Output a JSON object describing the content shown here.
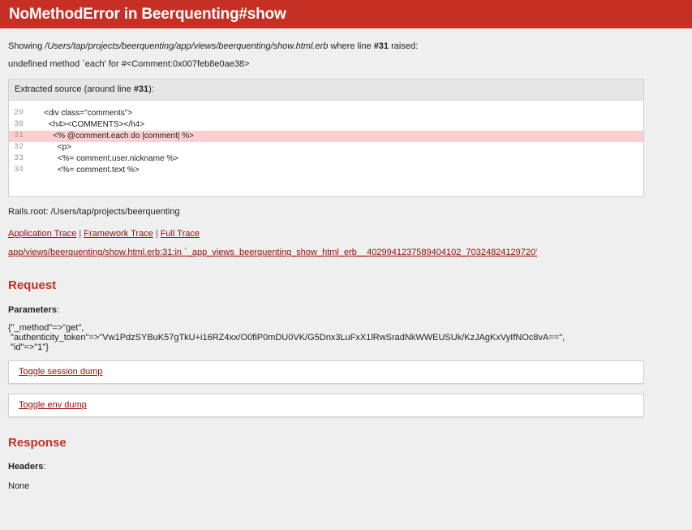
{
  "header": {
    "title": "NoMethodError in Beerquenting#show"
  },
  "showing": {
    "prefix": "Showing ",
    "path": "/Users/tap/projects/beerquenting/app/views/beerquenting/show.html.erb",
    "middle": " where line ",
    "line": "#31",
    "suffix": " raised:"
  },
  "error_message": "undefined method `each' for #<Comment:0x007feb8e0ae38>",
  "source": {
    "head_prefix": "Extracted source (around line ",
    "head_line": "#31",
    "head_suffix": "):",
    "lines": [
      {
        "num": "29",
        "code": "    <div class=\"comments\">"
      },
      {
        "num": "30",
        "code": "      <h4><COMMENTS></h4>"
      },
      {
        "num": "31",
        "code": "        <% @comment.each do |comment| %>"
      },
      {
        "num": "32",
        "code": "          <p>"
      },
      {
        "num": "33",
        "code": "          <%= comment.user.nickname %>"
      },
      {
        "num": "34",
        "code": "          <%= comment.text %>"
      }
    ]
  },
  "rails_root": "Rails.root: /Users/tap/projects/beerquenting",
  "trace_links": {
    "application": "Application Trace",
    "framework": "Framework Trace",
    "full": "Full Trace",
    "separator": "|"
  },
  "trace_path": "app/views/beerquenting/show.html.erb:31:in `_app_views_beerquenting_show_html_erb__4029941237589404102_70324824129720'",
  "request": {
    "heading": "Request",
    "params_label": "Parameters",
    "params_value": "{\"_method\"=>\"get\",\n \"authenticity_token\"=>\"Vw1PdzSYBuK57gTkU+i16RZ4xx/O0fiP0mDU0VK/G5Dnx3LuFxX1lRwSradNkWWEUSUk/KzJAgKxVyIfNOc8vA==\",\n \"id\"=>\"1\"}",
    "toggle_session": "Toggle session dump",
    "toggle_env": "Toggle env dump"
  },
  "response": {
    "heading": "Response",
    "headers_label": "Headers",
    "headers_value": "None"
  },
  "colors": {
    "header_bg": "#c52f24",
    "highlight_line": "#fccfcf",
    "link": "#980905"
  }
}
